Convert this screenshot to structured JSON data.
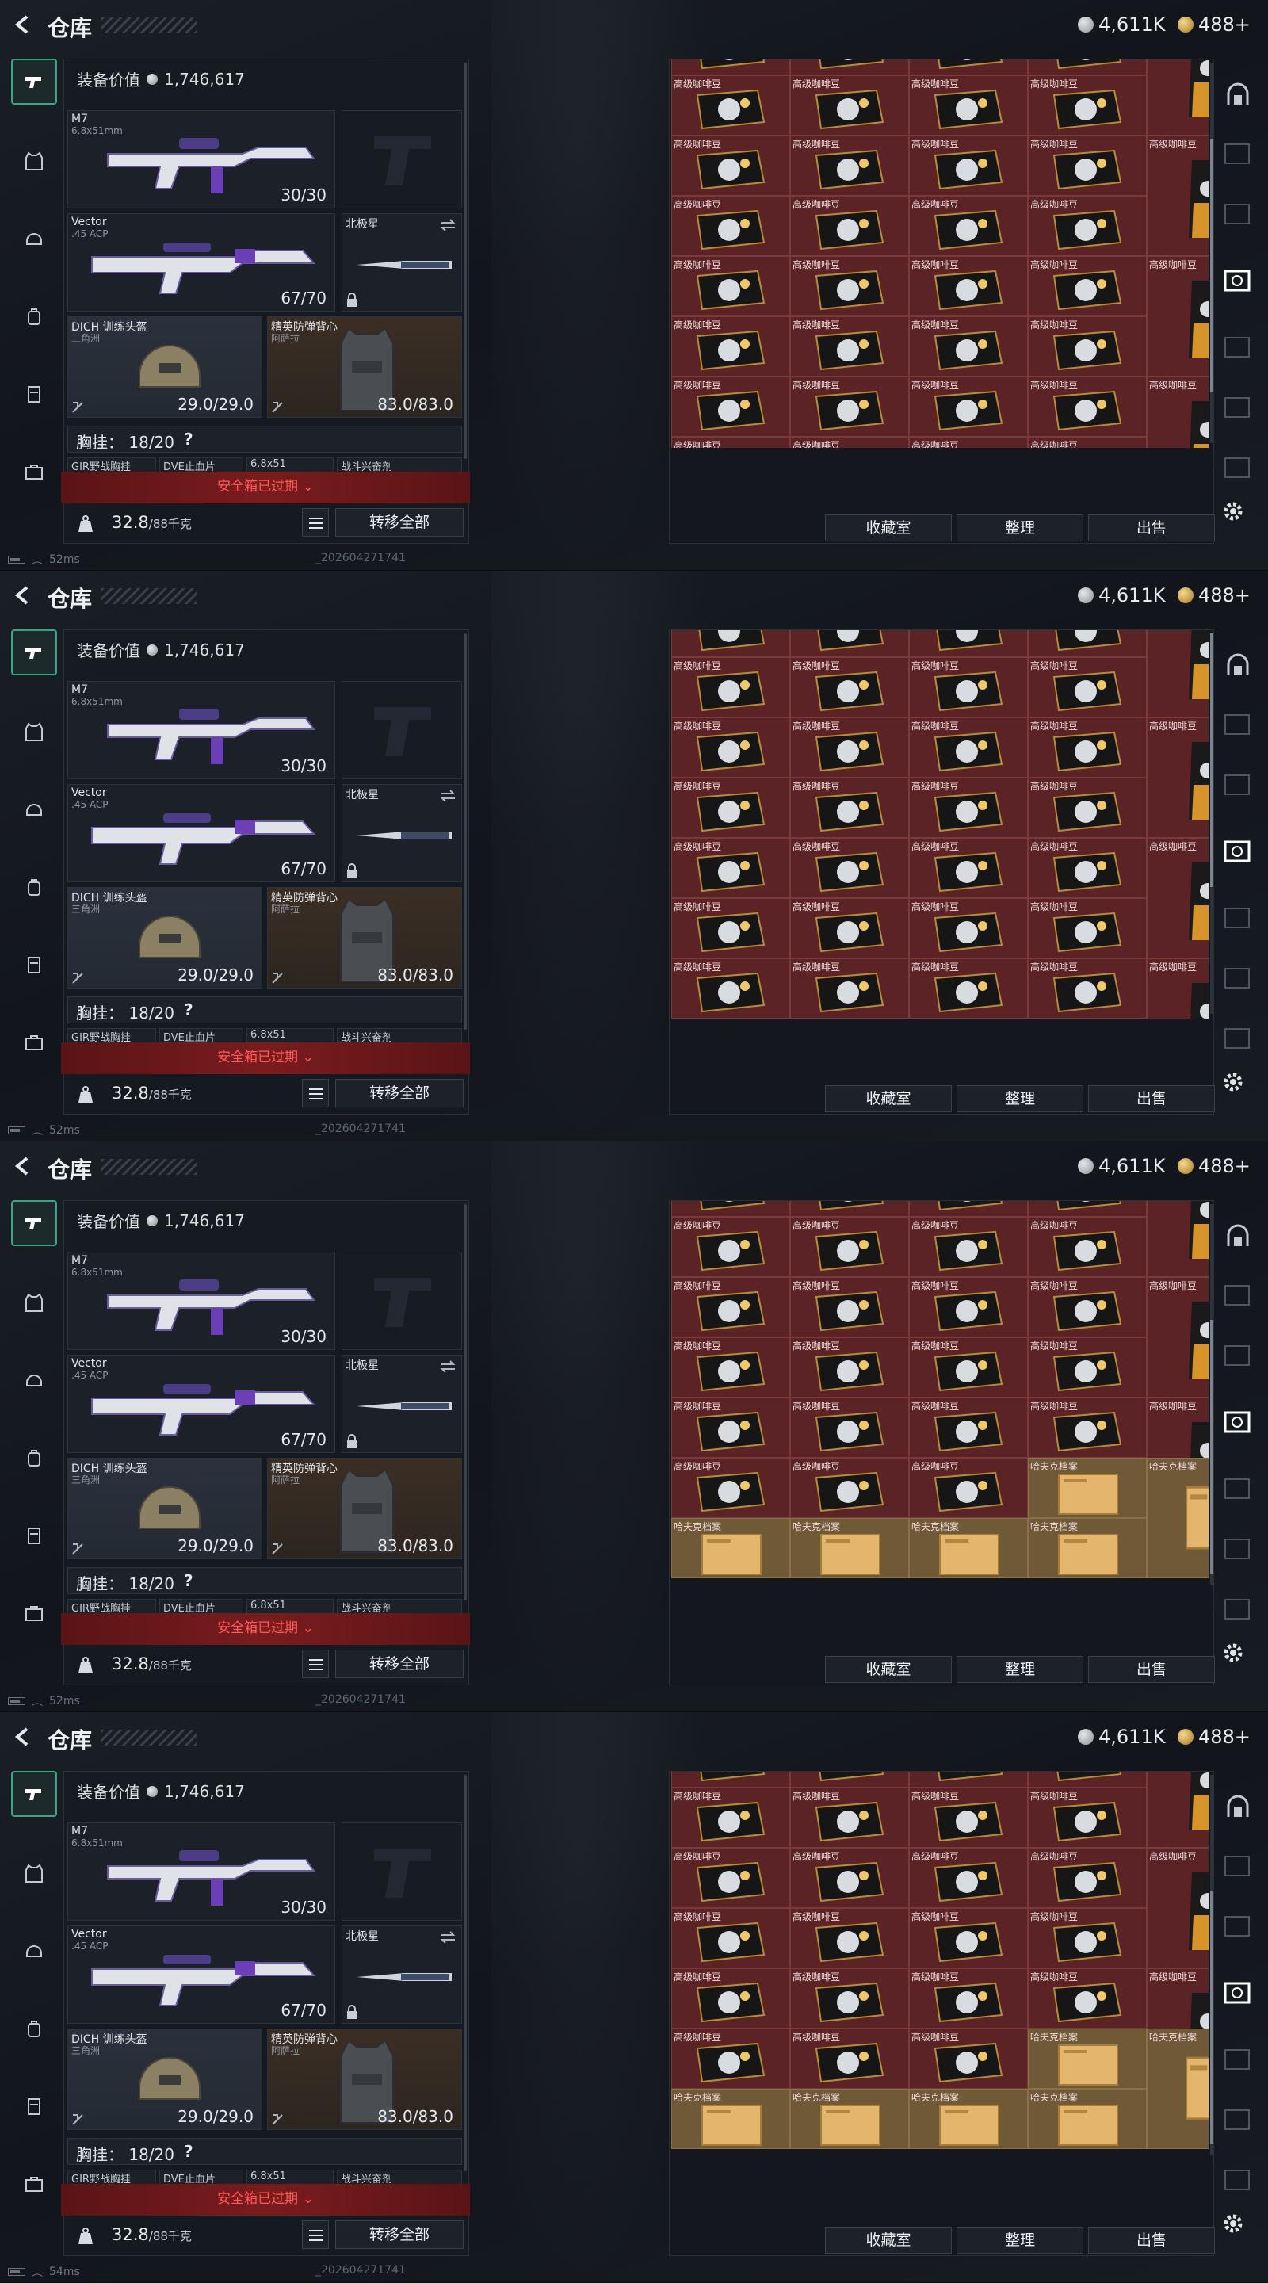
{
  "title": "仓库",
  "currency": {
    "silver": "4,611K",
    "gold": "488+"
  },
  "loadout": {
    "gear_value_label": "装备价值",
    "gear_value": "1,746,617",
    "primary": {
      "name": "M7",
      "caliber": "6.8x51mm",
      "ammo": "30/30"
    },
    "secondary": {
      "name": "Vector",
      "caliber": ".45 ACP",
      "ammo": "67/70"
    },
    "melee": {
      "name": "北极星"
    },
    "helmet": {
      "name": "DICH 训练头盔",
      "sub": "三角洲",
      "durability": "29.0/29.0"
    },
    "armor": {
      "name": "精英防弹背心",
      "sub": "阿萨拉",
      "durability": "83.0/83.0"
    },
    "rig_label": "胸挂：",
    "rig_count": "18/20",
    "rig_help": "?",
    "pouches": [
      "GIR野战胸挂",
      "DVE止血片",
      "6.8x51",
      "战斗兴奋剂"
    ],
    "safebox_expired": "安全箱已过期",
    "weight": "32.8",
    "weight_unit": "/88千克",
    "transfer_all": "转移全部"
  },
  "stash": {
    "coffee_label": "高级咖啡豆",
    "dossier_label": "哈夫克档案",
    "buttons": {
      "collection": "收藏室",
      "sort": "整理",
      "sell": "出售"
    }
  },
  "status": {
    "pings": [
      "52ms",
      "52ms",
      "52ms",
      "54ms"
    ],
    "build": "_202604271741"
  },
  "colors": {
    "accent": "#3aa489",
    "alert": "#ff5a5a",
    "cell": "#5b2325",
    "cell_gold": "#6f5936"
  },
  "icons": [
    "back-icon",
    "pistol-icon",
    "armor-icon",
    "helmet-icon",
    "backpack-icon",
    "rig-icon",
    "briefcase-icon",
    "lock-icon",
    "list-icon",
    "gear-icon"
  ]
}
